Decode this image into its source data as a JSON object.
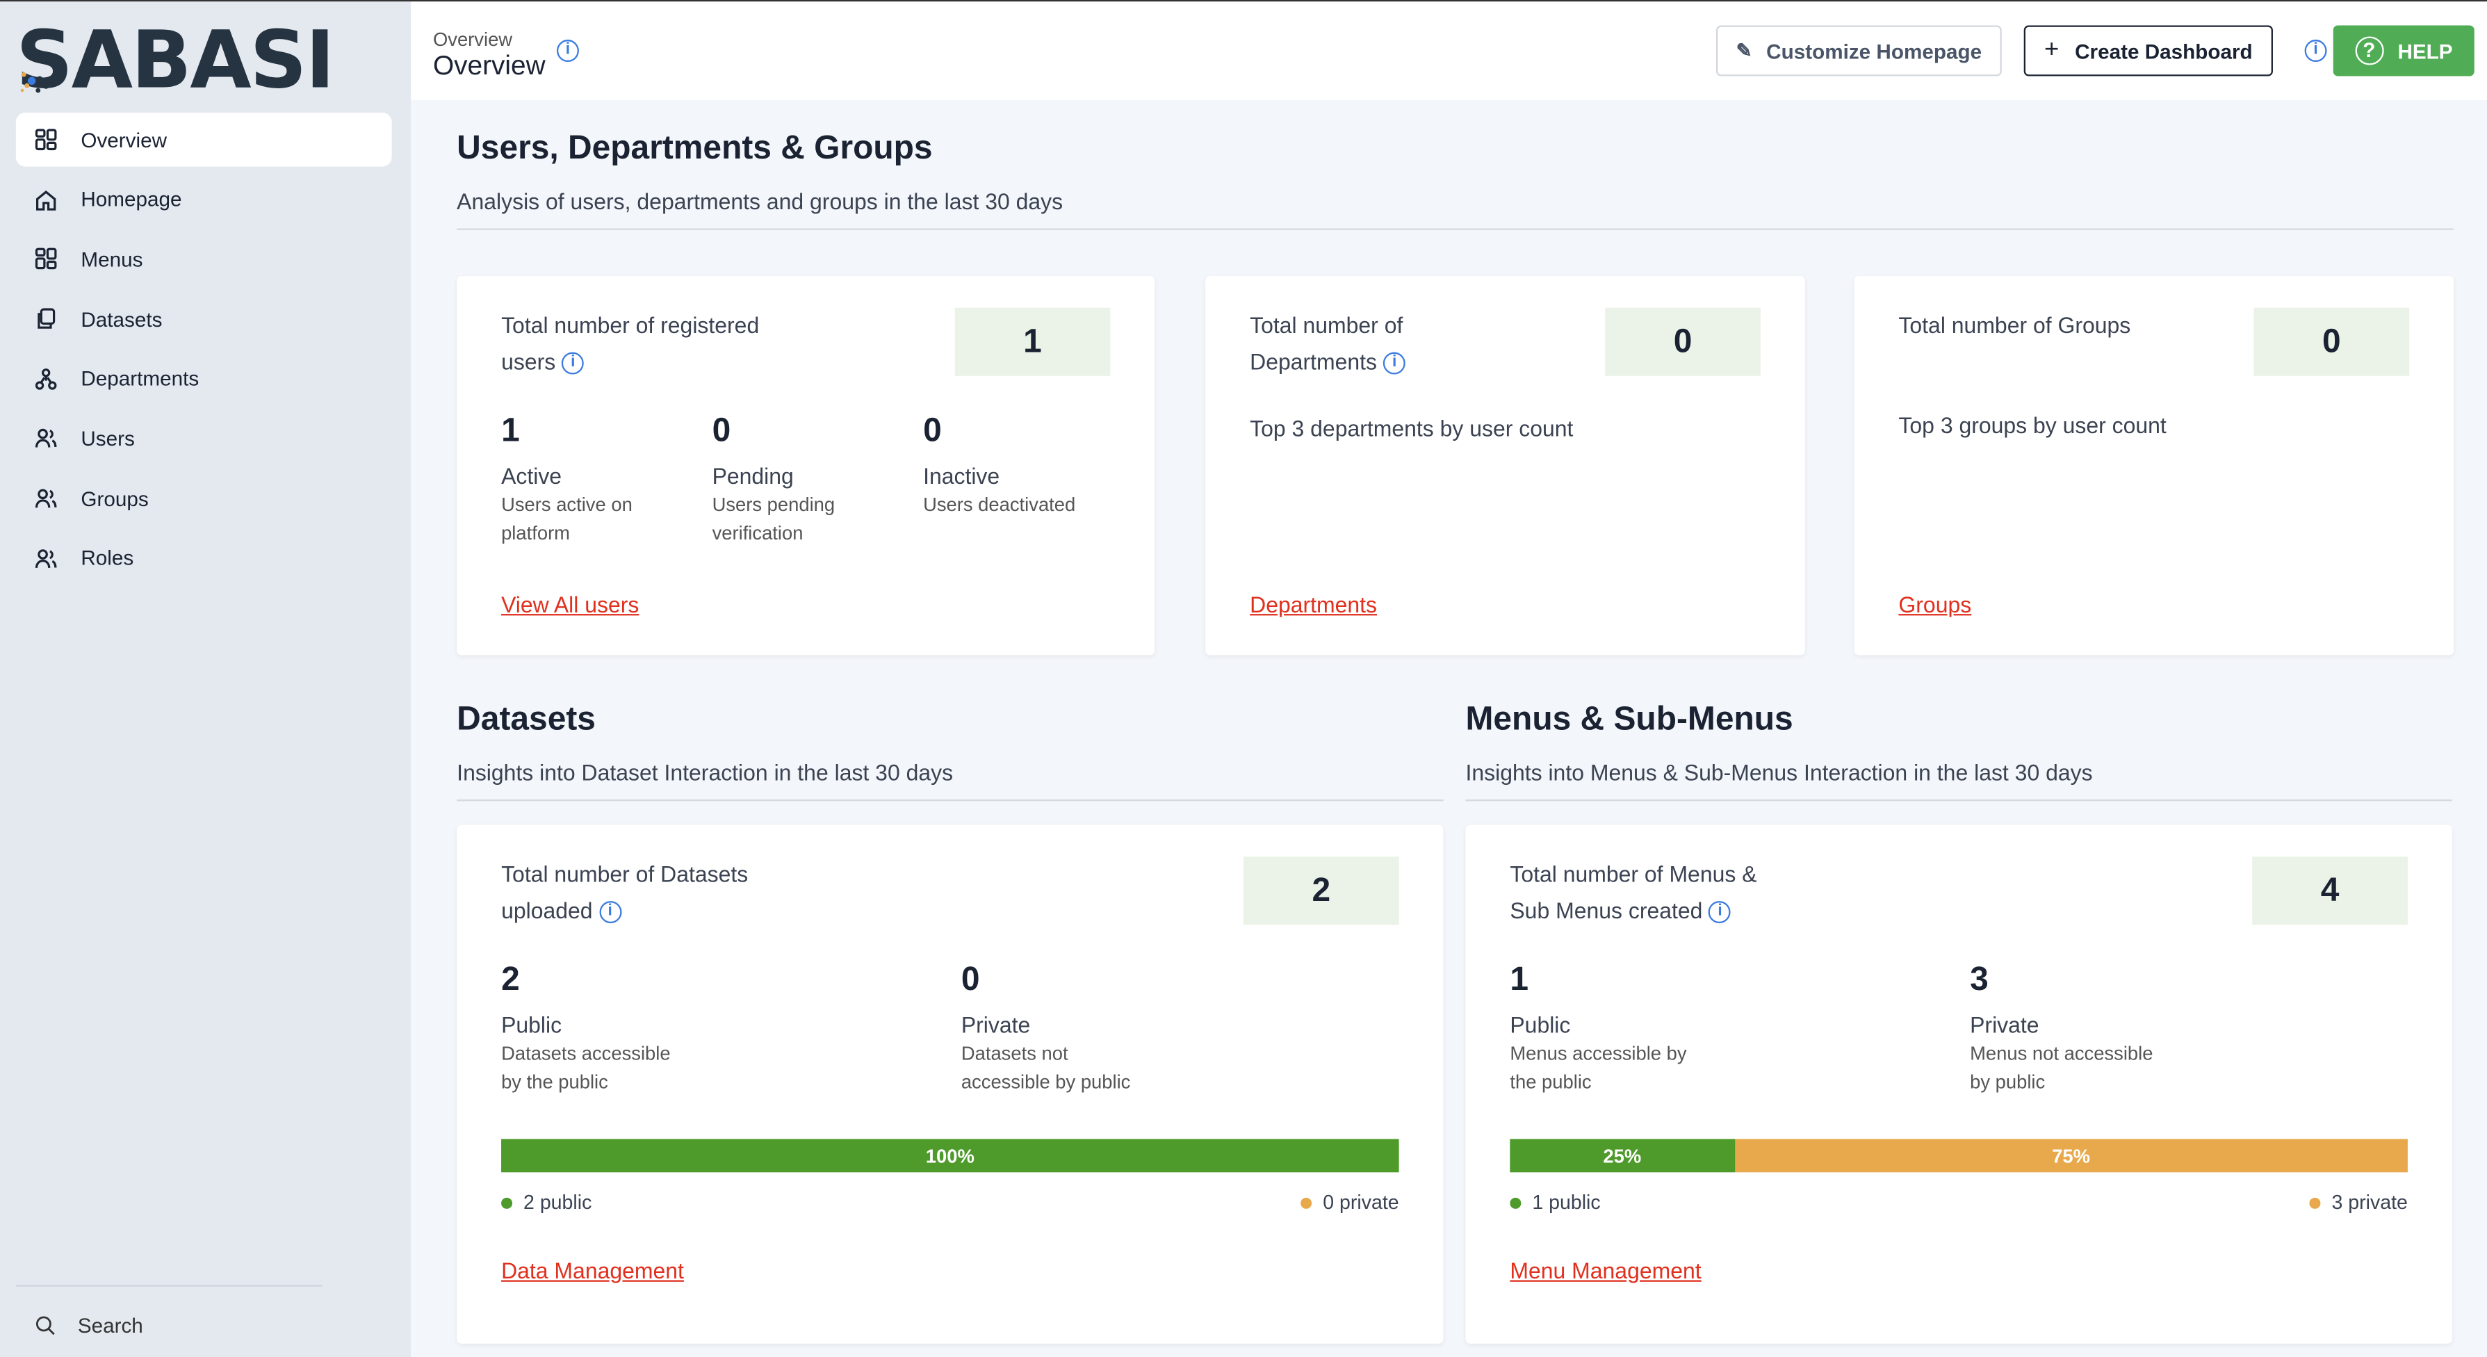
{
  "brand": {
    "logo": "SABASI"
  },
  "colors": {
    "accent_green": "#50ad55",
    "bar_public": "#4e9a2a",
    "bar_private": "#e8a94c",
    "link": "#e0301e",
    "info": "#3b7be0"
  },
  "sidebar": {
    "items": [
      {
        "label": "Overview",
        "icon": "grid-icon",
        "active": true
      },
      {
        "label": "Homepage",
        "icon": "home-icon"
      },
      {
        "label": "Menus",
        "icon": "grid-icon"
      },
      {
        "label": "Datasets",
        "icon": "copy-icon"
      },
      {
        "label": "Departments",
        "icon": "hierarchy-icon"
      },
      {
        "label": "Users",
        "icon": "users-icon"
      },
      {
        "label": "Groups",
        "icon": "users-icon"
      },
      {
        "label": "Roles",
        "icon": "users-icon"
      }
    ],
    "search_label": "Search"
  },
  "header": {
    "breadcrumb": "Overview",
    "title": "Overview",
    "customize": "Customize Homepage",
    "create": "Create Dashboard",
    "help": "HELP"
  },
  "udg": {
    "title": "Users, Departments & Groups",
    "subtitle": "Analysis of users, departments and groups in the last 30 days",
    "users": {
      "label": "Total number of registered users",
      "value": "1",
      "stats": [
        {
          "n": "1",
          "label": "Active",
          "desc": "Users active on platform"
        },
        {
          "n": "0",
          "label": "Pending",
          "desc": "Users pending verification"
        },
        {
          "n": "0",
          "label": "Inactive",
          "desc": "Users deactivated"
        }
      ],
      "link": "View All users"
    },
    "departments": {
      "label": "Total number of Departments",
      "value": "0",
      "sub": "Top 3 departments by user count",
      "link": "Departments"
    },
    "groups": {
      "label": "Total number of Groups",
      "value": "0",
      "sub": "Top 3 groups by user count",
      "link": "Groups"
    }
  },
  "datasets": {
    "title": "Datasets",
    "subtitle": "Insights into Dataset Interaction in the last 30 days",
    "label": "Total number of Datasets uploaded",
    "value": "2",
    "stats": [
      {
        "n": "2",
        "label": "Public",
        "desc": "Datasets accessible by the public"
      },
      {
        "n": "0",
        "label": "Private",
        "desc": "Datasets not accessible by public"
      }
    ],
    "public_pct": 100,
    "public_label": "100%",
    "private_label": "",
    "legend_public": "2 public",
    "legend_private": "0 private",
    "link": "Data Management"
  },
  "menus": {
    "title": "Menus & Sub-Menus",
    "subtitle": "Insights into Menus & Sub-Menus Interaction in the last 30 days",
    "label": "Total number of Menus & Sub Menus created",
    "value": "4",
    "stats": [
      {
        "n": "1",
        "label": "Public",
        "desc": "Menus accessible by the public"
      },
      {
        "n": "3",
        "label": "Private",
        "desc": "Menus not accessible by public"
      }
    ],
    "public_pct": 25,
    "public_label": "25%",
    "private_label": "75%",
    "legend_public": "1 public",
    "legend_private": "3 private",
    "link": "Menu Management"
  }
}
